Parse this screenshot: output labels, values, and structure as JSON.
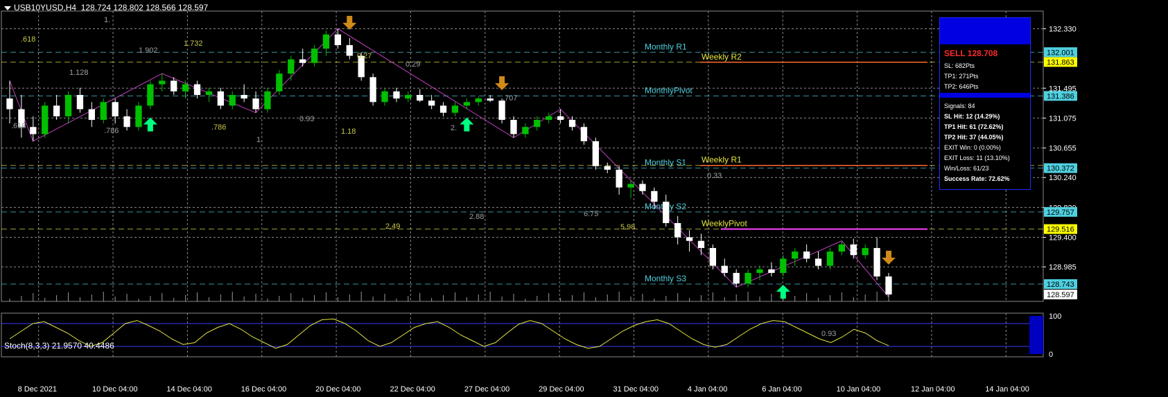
{
  "header": {
    "symbol": "USB10YUSD,H4",
    "ohlc": "128.724 128.802 128.566 128.597"
  },
  "stoch_header": "Stoch(8,3,3) 21.9570 40.4486",
  "colors": {
    "bull": "#00c000",
    "bear": "#ffffff",
    "grid": "#8a8a8a",
    "pivot": "#4fd0e0",
    "weekly": "#e8e840",
    "zigzag": "#c040c0",
    "up_arrow": "#00ff80",
    "down_arrow": "#d08a1a"
  },
  "chart_data": {
    "type": "candlestick",
    "instrument": "USB10YUSD",
    "timeframe": "H4",
    "ylim": [
      128.5,
      132.5
    ],
    "y_ticks": [
      "132.330",
      "131.495",
      "131.075",
      "130.655",
      "130.240",
      "129.820",
      "129.400",
      "128.985"
    ],
    "x_ticks": [
      "8 Dec 2021",
      "10 Dec 04:00",
      "14 Dec 04:00",
      "16 Dec 04:00",
      "20 Dec 04:00",
      "22 Dec 04:00",
      "27 Dec 04:00",
      "29 Dec 04:00",
      "31 Dec 04:00",
      "4 Jan 04:00",
      "6 Jan 04:00",
      "10 Jan 04:00",
      "12 Jan 04:00",
      "14 Jan 04:00"
    ],
    "price_tags": [
      {
        "value": "132.001",
        "color": "#4fd0e0"
      },
      {
        "value": "131.863",
        "color": "#ffff00"
      },
      {
        "value": "131.386",
        "color": "#4fd0e0"
      },
      {
        "value": "130.372",
        "color": "#4fd0e0"
      },
      {
        "value": "129.757",
        "color": "#4fd0e0"
      },
      {
        "value": "129.516",
        "color": "#ffff00"
      },
      {
        "value": "128.743",
        "color": "#4fd0e0"
      },
      {
        "value": "128.597",
        "color": "#ffffff"
      }
    ],
    "levels": [
      {
        "label": "Monthly R1",
        "price": 132.0,
        "kind": "monthly"
      },
      {
        "label": "Weekly R2",
        "price": 131.86,
        "kind": "weekly"
      },
      {
        "label": "MonthlyPivot",
        "price": 131.386,
        "kind": "monthly"
      },
      {
        "label": "Monthly S1",
        "price": 130.372,
        "kind": "monthly"
      },
      {
        "label": "Weekly R1",
        "price": 130.41,
        "kind": "weekly"
      },
      {
        "label": "Monthly S2",
        "price": 129.757,
        "kind": "monthly"
      },
      {
        "label": "WeeklyPivot",
        "price": 129.516,
        "kind": "weekly"
      },
      {
        "label": "Monthly S3",
        "price": 128.743,
        "kind": "monthly"
      }
    ],
    "fib_labels": [
      ".618",
      "1.",
      "1.902",
      "1.732",
      "1.128",
      ".786",
      ".786",
      ".618",
      "1.",
      "0.27",
      "0.29",
      "0.93",
      "1.18",
      ".707",
      "2.",
      "2.49",
      "2.88",
      "6.75",
      "5.98",
      "0.33",
      "0.93"
    ],
    "candles": [
      [
        131.35,
        131.6,
        131.0,
        131.2
      ],
      [
        131.2,
        131.4,
        130.8,
        130.95
      ],
      [
        130.95,
        131.1,
        130.75,
        130.85
      ],
      [
        130.85,
        131.3,
        130.8,
        131.25
      ],
      [
        131.25,
        131.4,
        131.05,
        131.1
      ],
      [
        131.1,
        131.45,
        131.0,
        131.4
      ],
      [
        131.4,
        131.5,
        131.15,
        131.2
      ],
      [
        131.2,
        131.3,
        130.95,
        131.05
      ],
      [
        131.05,
        131.35,
        131.0,
        131.3
      ],
      [
        131.3,
        131.35,
        131.0,
        131.1
      ],
      [
        131.1,
        131.2,
        130.9,
        130.95
      ],
      [
        130.95,
        131.3,
        130.9,
        131.25
      ],
      [
        131.25,
        131.6,
        131.2,
        131.55
      ],
      [
        131.55,
        131.7,
        131.45,
        131.6
      ],
      [
        131.6,
        131.65,
        131.4,
        131.45
      ],
      [
        131.45,
        131.6,
        131.35,
        131.55
      ],
      [
        131.55,
        131.6,
        131.35,
        131.4
      ],
      [
        131.4,
        131.5,
        131.3,
        131.45
      ],
      [
        131.45,
        131.5,
        131.2,
        131.25
      ],
      [
        131.25,
        131.45,
        131.2,
        131.4
      ],
      [
        131.4,
        131.55,
        131.3,
        131.35
      ],
      [
        131.35,
        131.45,
        131.15,
        131.2
      ],
      [
        131.2,
        131.5,
        131.15,
        131.45
      ],
      [
        131.45,
        131.75,
        131.4,
        131.7
      ],
      [
        131.7,
        131.95,
        131.6,
        131.9
      ],
      [
        131.9,
        132.05,
        131.8,
        131.85
      ],
      [
        131.85,
        132.1,
        131.8,
        132.05
      ],
      [
        132.05,
        132.3,
        131.95,
        132.25
      ],
      [
        132.25,
        132.33,
        132.05,
        132.1
      ],
      [
        132.1,
        132.2,
        131.9,
        131.95
      ],
      [
        131.95,
        132.0,
        131.6,
        131.65
      ],
      [
        131.65,
        131.7,
        131.25,
        131.3
      ],
      [
        131.3,
        131.5,
        131.25,
        131.45
      ],
      [
        131.45,
        131.5,
        131.3,
        131.35
      ],
      [
        131.35,
        131.45,
        131.3,
        131.4
      ],
      [
        131.4,
        131.48,
        131.3,
        131.32
      ],
      [
        131.32,
        131.4,
        131.2,
        131.25
      ],
      [
        131.25,
        131.3,
        131.1,
        131.15
      ],
      [
        131.15,
        131.3,
        131.1,
        131.25
      ],
      [
        131.25,
        131.35,
        131.2,
        131.3
      ],
      [
        131.3,
        131.38,
        131.25,
        131.35
      ],
      [
        131.35,
        131.4,
        131.3,
        131.32
      ],
      [
        131.32,
        131.35,
        131.0,
        131.05
      ],
      [
        131.05,
        131.1,
        130.8,
        130.85
      ],
      [
        130.85,
        131.0,
        130.8,
        130.95
      ],
      [
        130.95,
        131.1,
        130.9,
        131.05
      ],
      [
        131.05,
        131.15,
        131.0,
        131.1
      ],
      [
        131.1,
        131.2,
        131.0,
        131.05
      ],
      [
        131.05,
        131.1,
        130.9,
        130.95
      ],
      [
        130.95,
        131.0,
        130.7,
        130.75
      ],
      [
        130.75,
        130.8,
        130.35,
        130.4
      ],
      [
        130.4,
        130.45,
        130.3,
        130.35
      ],
      [
        130.35,
        130.4,
        130.0,
        130.1
      ],
      [
        130.1,
        130.2,
        129.95,
        130.15
      ],
      [
        130.15,
        130.2,
        130.0,
        130.05
      ],
      [
        130.05,
        130.1,
        129.8,
        129.9
      ],
      [
        129.9,
        130.0,
        129.55,
        129.6
      ],
      [
        129.6,
        129.7,
        129.3,
        129.4
      ],
      [
        129.4,
        129.5,
        129.2,
        129.35
      ],
      [
        129.35,
        129.45,
        129.15,
        129.25
      ],
      [
        129.25,
        129.3,
        128.95,
        129.0
      ],
      [
        129.0,
        129.1,
        128.85,
        128.9
      ],
      [
        128.9,
        128.95,
        128.7,
        128.75
      ],
      [
        128.75,
        128.95,
        128.7,
        128.9
      ],
      [
        128.9,
        129.0,
        128.8,
        128.95
      ],
      [
        128.95,
        129.05,
        128.85,
        128.9
      ],
      [
        128.9,
        129.15,
        128.85,
        129.1
      ],
      [
        129.1,
        129.25,
        129.0,
        129.2
      ],
      [
        129.2,
        129.3,
        129.05,
        129.1
      ],
      [
        129.1,
        129.2,
        128.95,
        129.0
      ],
      [
        129.0,
        129.25,
        128.95,
        129.2
      ],
      [
        129.2,
        129.35,
        129.15,
        129.3
      ],
      [
        129.3,
        129.38,
        129.1,
        129.15
      ],
      [
        129.15,
        129.3,
        129.1,
        129.25
      ],
      [
        129.25,
        129.4,
        128.8,
        128.85
      ],
      [
        128.85,
        128.9,
        128.56,
        128.597
      ]
    ],
    "signal_panel": {
      "title": "SELL 128.708",
      "lines": [
        "SL: 682Pts",
        "TP1: 271Pts",
        "TP2: 646Pts"
      ],
      "stats": [
        {
          "text": "Signals: 84",
          "bold": false
        },
        {
          "text": "SL Hit: 12 (14.29%)",
          "bold": true
        },
        {
          "text": "TP1 Hit: 61 (72.62%)",
          "bold": true
        },
        {
          "text": "TP2 Hit: 37 (44.05%)",
          "bold": true
        },
        {
          "text": "EXIT Win: 0 (0.00%)",
          "bold": false
        },
        {
          "text": "EXIT Loss: 11 (13.10%)",
          "bold": false
        },
        {
          "text": "Win/Loss: 61/23",
          "bold": false
        },
        {
          "text": "Success Rate: 72.62%",
          "bold": true
        }
      ]
    },
    "stochastic": {
      "params": "8,3,3",
      "main": 21.957,
      "signal": 40.4486,
      "levels": [
        "100",
        "0"
      ],
      "values": [
        40,
        60,
        80,
        85,
        70,
        55,
        35,
        20,
        30,
        55,
        80,
        88,
        75,
        60,
        40,
        25,
        30,
        55,
        70,
        80,
        65,
        45,
        30,
        15,
        25,
        50,
        75,
        90,
        92,
        80,
        60,
        35,
        20,
        30,
        50,
        70,
        80,
        85,
        70,
        50,
        35,
        20,
        30,
        55,
        78,
        88,
        80,
        60,
        40,
        25,
        15,
        20,
        40,
        60,
        75,
        85,
        90,
        80,
        60,
        40,
        25,
        18,
        25,
        45,
        65,
        80,
        88,
        85,
        70,
        55,
        40,
        30,
        45,
        65,
        55,
        35,
        22
      ]
    }
  }
}
